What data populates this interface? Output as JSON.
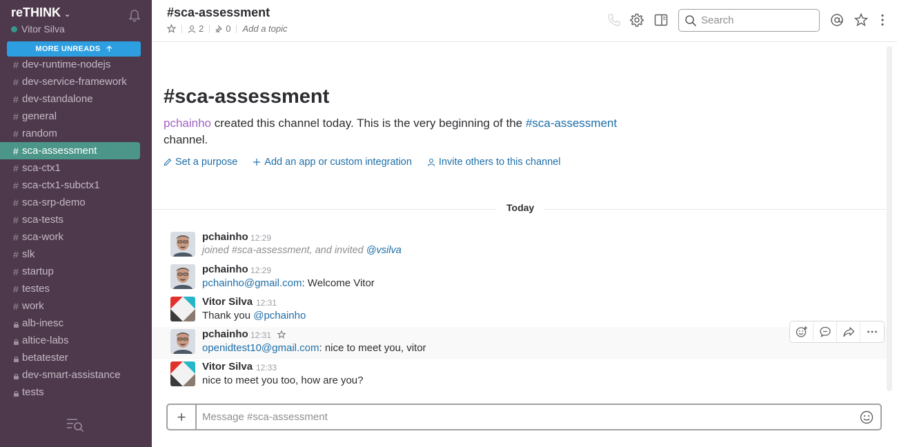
{
  "sidebar": {
    "team_name": "reTHINK",
    "user_name": "Vitor Silva",
    "more_unreads_label": "MORE UNREADS",
    "channels": [
      {
        "name": "dev-runtime-nodejs",
        "type": "public",
        "active": false
      },
      {
        "name": "dev-service-framework",
        "type": "public",
        "active": false
      },
      {
        "name": "dev-standalone",
        "type": "public",
        "active": false
      },
      {
        "name": "general",
        "type": "public",
        "active": false
      },
      {
        "name": "random",
        "type": "public",
        "active": false
      },
      {
        "name": "sca-assessment",
        "type": "public",
        "active": true
      },
      {
        "name": "sca-ctx1",
        "type": "public",
        "active": false
      },
      {
        "name": "sca-ctx1-subctx1",
        "type": "public",
        "active": false
      },
      {
        "name": "sca-srp-demo",
        "type": "public",
        "active": false
      },
      {
        "name": "sca-tests",
        "type": "public",
        "active": false
      },
      {
        "name": "sca-work",
        "type": "public",
        "active": false
      },
      {
        "name": "slk",
        "type": "public",
        "active": false
      },
      {
        "name": "startup",
        "type": "public",
        "active": false
      },
      {
        "name": "testes",
        "type": "public",
        "active": false
      },
      {
        "name": "work",
        "type": "public",
        "active": false
      },
      {
        "name": "alb-inesc",
        "type": "private",
        "active": false
      },
      {
        "name": "altice-labs",
        "type": "private",
        "active": false
      },
      {
        "name": "betatester",
        "type": "private",
        "active": false
      },
      {
        "name": "dev-smart-assistance",
        "type": "private",
        "active": false
      },
      {
        "name": "tests",
        "type": "private",
        "active": false
      }
    ]
  },
  "header": {
    "channel_title": "#sca-assessment",
    "member_count": "2",
    "pinned_count": "0",
    "topic_placeholder": "Add a topic",
    "search_placeholder": "Search"
  },
  "intro": {
    "title": "#sca-assessment",
    "creator": "pchainho",
    "text_before_link": " created this channel today. This is the very beginning of the ",
    "channel_link": "#sca-assessment",
    "text_after_link": " channel.",
    "actions": {
      "set_purpose": "Set a purpose",
      "add_app": "Add an app or custom integration",
      "invite": "Invite others to this channel"
    }
  },
  "day_divider": "Today",
  "messages": [
    {
      "author": "pchainho",
      "time": "12:29",
      "system_text": "joined #sca-assessment, and invited ",
      "mention": "@vsilva"
    },
    {
      "author": "pchainho",
      "time": "12:29",
      "link": "pchainho@gmail.com",
      "text": ": Welcome Vitor"
    },
    {
      "author": "Vitor Silva",
      "time": "12:31",
      "text": "Thank you ",
      "mention": "@pchainho"
    },
    {
      "author": "pchainho",
      "time": "12:31",
      "link": "openidtest10@gmail.com",
      "text": ": nice to meet you, vitor"
    },
    {
      "author": "Vitor Silva",
      "time": "12:33",
      "text": "nice to meet you too, how are you?"
    }
  ],
  "composer": {
    "placeholder": "Message #sca-assessment"
  },
  "colors": {
    "sidebar_bg": "#4d394b",
    "active_channel": "#4c9689",
    "more_unreads": "#2d9ee0",
    "link": "#1d6ea8",
    "creator": "#a063c5"
  }
}
